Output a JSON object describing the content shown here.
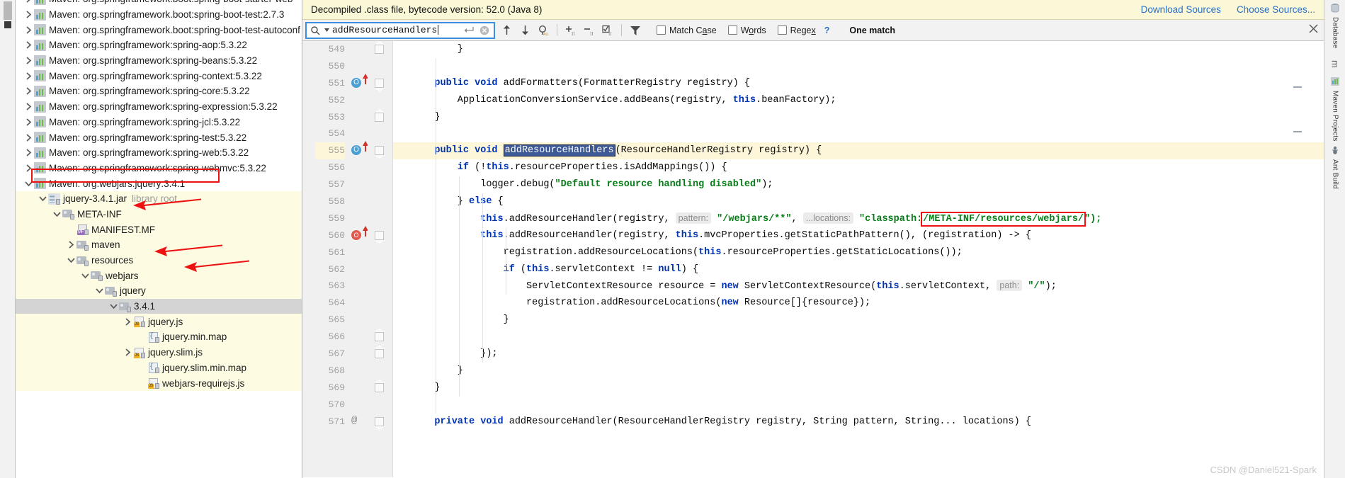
{
  "left_rail": {
    "label": "Database"
  },
  "tree": {
    "rows": [
      {
        "indent": 1,
        "twisty": "right",
        "icon": "maven-library-icon",
        "label": "Maven: org.springframework.boot:spring-boot-starter-web",
        "dim": "",
        "state": "normal",
        "clipped": true
      },
      {
        "indent": 1,
        "twisty": "right",
        "icon": "maven-library-icon",
        "label": "Maven: org.springframework.boot:spring-boot-test:2.7.3",
        "dim": "",
        "state": "normal"
      },
      {
        "indent": 1,
        "twisty": "right",
        "icon": "maven-library-icon",
        "label": "Maven: org.springframework.boot:spring-boot-test-autoconf",
        "dim": "",
        "state": "normal"
      },
      {
        "indent": 1,
        "twisty": "right",
        "icon": "maven-library-icon",
        "label": "Maven: org.springframework:spring-aop:5.3.22",
        "dim": "",
        "state": "normal"
      },
      {
        "indent": 1,
        "twisty": "right",
        "icon": "maven-library-icon",
        "label": "Maven: org.springframework:spring-beans:5.3.22",
        "dim": "",
        "state": "normal"
      },
      {
        "indent": 1,
        "twisty": "right",
        "icon": "maven-library-icon",
        "label": "Maven: org.springframework:spring-context:5.3.22",
        "dim": "",
        "state": "normal"
      },
      {
        "indent": 1,
        "twisty": "right",
        "icon": "maven-library-icon",
        "label": "Maven: org.springframework:spring-core:5.3.22",
        "dim": "",
        "state": "normal"
      },
      {
        "indent": 1,
        "twisty": "right",
        "icon": "maven-library-icon",
        "label": "Maven: org.springframework:spring-expression:5.3.22",
        "dim": "",
        "state": "normal"
      },
      {
        "indent": 1,
        "twisty": "right",
        "icon": "maven-library-icon",
        "label": "Maven: org.springframework:spring-jcl:5.3.22",
        "dim": "",
        "state": "normal"
      },
      {
        "indent": 1,
        "twisty": "right",
        "icon": "maven-library-icon",
        "label": "Maven: org.springframework:spring-test:5.3.22",
        "dim": "",
        "state": "normal"
      },
      {
        "indent": 1,
        "twisty": "right",
        "icon": "maven-library-icon",
        "label": "Maven: org.springframework:spring-web:5.3.22",
        "dim": "",
        "state": "normal"
      },
      {
        "indent": 1,
        "twisty": "right",
        "icon": "maven-library-icon",
        "label": "Maven: org.springframework:spring-webmvc:5.3.22",
        "dim": "",
        "state": "normal"
      },
      {
        "indent": 1,
        "twisty": "down",
        "icon": "maven-library-icon",
        "label": "Maven: org.webjars:jquery:3.4.1",
        "dim": "",
        "state": "normal"
      },
      {
        "indent": 2,
        "twisty": "down",
        "icon": "jar-icon",
        "label": "jquery-3.4.1.jar",
        "dim": "library root",
        "state": "jar"
      },
      {
        "indent": 3,
        "twisty": "down",
        "icon": "folder-icon",
        "label": "META-INF",
        "dim": "",
        "state": "jar"
      },
      {
        "indent": 4,
        "twisty": "none",
        "icon": "manifest-file-icon",
        "label": "MANIFEST.MF",
        "dim": "",
        "state": "jar"
      },
      {
        "indent": 4,
        "twisty": "right",
        "icon": "folder-icon",
        "label": "maven",
        "dim": "",
        "state": "jar"
      },
      {
        "indent": 4,
        "twisty": "down",
        "icon": "folder-icon",
        "label": "resources",
        "dim": "",
        "state": "jar"
      },
      {
        "indent": 5,
        "twisty": "down",
        "icon": "folder-icon",
        "label": "webjars",
        "dim": "",
        "state": "jar"
      },
      {
        "indent": 6,
        "twisty": "down",
        "icon": "folder-icon",
        "label": "jquery",
        "dim": "",
        "state": "jar"
      },
      {
        "indent": 7,
        "twisty": "down",
        "icon": "folder-icon",
        "label": "3.4.1",
        "dim": "",
        "state": "selected"
      },
      {
        "indent": 8,
        "twisty": "right",
        "icon": "js-file-icon",
        "label": "jquery.js",
        "dim": "",
        "state": "jar"
      },
      {
        "indent": 9,
        "twisty": "none",
        "icon": "map-file-icon",
        "label": "jquery.min.map",
        "dim": "",
        "state": "jar"
      },
      {
        "indent": 8,
        "twisty": "right",
        "icon": "js-file-icon",
        "label": "jquery.slim.js",
        "dim": "",
        "state": "jar"
      },
      {
        "indent": 9,
        "twisty": "none",
        "icon": "map-file-icon",
        "label": "jquery.slim.min.map",
        "dim": "",
        "state": "jar"
      },
      {
        "indent": 9,
        "twisty": "none",
        "icon": "js-file-icon",
        "label": "webjars-requirejs.js",
        "dim": "",
        "state": "jar"
      }
    ],
    "annotation_color": "#ee1111"
  },
  "notification": {
    "text": "Decompiled .class file, bytecode version: 52.0 (Java 8)",
    "download_sources": "Download Sources",
    "choose_sources": "Choose Sources...",
    "link_color": "#2a6fc9",
    "background": "#fbf8d7"
  },
  "find_bar": {
    "query": "addResourceHandlers",
    "match_case_label": "Match Case",
    "match_case_checked": false,
    "words_label": "Words",
    "words_checked": false,
    "regex_label": "Regex",
    "regex_checked": false,
    "help_label": "?",
    "result_text": "One match",
    "icons": [
      "search-icon",
      "enter-icon",
      "clear-icon",
      "prev-occurrence-icon",
      "next-occurrence-icon",
      "select-all-occurrences-icon",
      "add-line-icon",
      "remove-line-icon",
      "toggle-selection-icon",
      "filter-icon",
      "close-icon"
    ]
  },
  "editor": {
    "first_line": 549,
    "lines": [
      {
        "num": 549,
        "segments": [
          {
            "t": "        }",
            "c": "plain"
          }
        ],
        "hl": false
      },
      {
        "num": 550,
        "segments": [],
        "hl": false
      },
      {
        "num": 551,
        "segments": [
          {
            "t": "    ",
            "c": "plain"
          },
          {
            "t": "public void",
            "c": "kw"
          },
          {
            "t": " addFormatters(FormatterRegistry registry) {",
            "c": "plain"
          }
        ],
        "hl": false,
        "gutter": "override"
      },
      {
        "num": 552,
        "segments": [
          {
            "t": "        ApplicationConversionService.addBeans(registry, ",
            "c": "plain"
          },
          {
            "t": "this",
            "c": "kw"
          },
          {
            "t": ".beanFactory);",
            "c": "plain"
          }
        ],
        "hl": false
      },
      {
        "num": 553,
        "segments": [
          {
            "t": "    }",
            "c": "plain"
          }
        ],
        "hl": false
      },
      {
        "num": 554,
        "segments": [],
        "hl": false
      },
      {
        "num": 555,
        "segments": [
          {
            "t": "    ",
            "c": "plain"
          },
          {
            "t": "public void",
            "c": "kw"
          },
          {
            "t": " ",
            "c": "plain"
          },
          {
            "t": "addResourceHandlers",
            "c": "selhl"
          },
          {
            "t": "(ResourceHandlerRegistry registry) {",
            "c": "plain"
          }
        ],
        "hl": true,
        "gutter": "override"
      },
      {
        "num": 556,
        "segments": [
          {
            "t": "        ",
            "c": "plain"
          },
          {
            "t": "if",
            "c": "kw"
          },
          {
            "t": " (!",
            "c": "plain"
          },
          {
            "t": "this",
            "c": "kw"
          },
          {
            "t": ".resourceProperties.isAddMappings()) {",
            "c": "plain"
          }
        ],
        "hl": false
      },
      {
        "num": 557,
        "segments": [
          {
            "t": "            logger.debug(",
            "c": "plain"
          },
          {
            "t": "\"Default resource handling disabled\"",
            "c": "str"
          },
          {
            "t": ");",
            "c": "plain"
          }
        ],
        "hl": false
      },
      {
        "num": 558,
        "segments": [
          {
            "t": "        } ",
            "c": "plain"
          },
          {
            "t": "else",
            "c": "kw"
          },
          {
            "t": " {",
            "c": "plain"
          }
        ],
        "hl": false
      },
      {
        "num": 559,
        "segments": [
          {
            "t": "            ",
            "c": "plain"
          },
          {
            "t": "this",
            "c": "kw"
          },
          {
            "t": ".addResourceHandler(registry, ",
            "c": "plain"
          },
          {
            "t": "pattern:",
            "c": "hint"
          },
          {
            "t": " ",
            "c": "plain"
          },
          {
            "t": "\"/webjars/**\"",
            "c": "str"
          },
          {
            "t": ", ",
            "c": "plain"
          },
          {
            "t": "...locations:",
            "c": "hint"
          },
          {
            "t": " ",
            "c": "plain"
          },
          {
            "t": "\"classpath:",
            "c": "str"
          },
          {
            "t": "/META-INF/resources/webjars/",
            "c": "str-boxed"
          },
          {
            "t": "\");",
            "c": "str"
          }
        ],
        "hl": false
      },
      {
        "num": 560,
        "segments": [
          {
            "t": "            ",
            "c": "plain"
          },
          {
            "t": "this",
            "c": "kw"
          },
          {
            "t": ".addResourceHandler(registry, ",
            "c": "plain"
          },
          {
            "t": "this",
            "c": "kw"
          },
          {
            "t": ".mvcProperties.getStaticPathPattern(), ",
            "c": "plain"
          },
          {
            "t": "(registration)",
            "c": "plain"
          },
          {
            "t": " -> {",
            "c": "plain"
          }
        ],
        "hl": false,
        "gutter": "impl"
      },
      {
        "num": 561,
        "segments": [
          {
            "t": "                registration.addResourceLocations(",
            "c": "plain"
          },
          {
            "t": "this",
            "c": "kw"
          },
          {
            "t": ".resourceProperties.getStaticLocations());",
            "c": "plain"
          }
        ],
        "hl": false
      },
      {
        "num": 562,
        "segments": [
          {
            "t": "                ",
            "c": "plain"
          },
          {
            "t": "if",
            "c": "kw"
          },
          {
            "t": " (",
            "c": "plain"
          },
          {
            "t": "this",
            "c": "kw"
          },
          {
            "t": ".servletContext != ",
            "c": "plain"
          },
          {
            "t": "null",
            "c": "kw"
          },
          {
            "t": ") {",
            "c": "plain"
          }
        ],
        "hl": false
      },
      {
        "num": 563,
        "segments": [
          {
            "t": "                    ServletContextResource resource = ",
            "c": "plain"
          },
          {
            "t": "new",
            "c": "kw"
          },
          {
            "t": " ServletContextResource(",
            "c": "plain"
          },
          {
            "t": "this",
            "c": "kw"
          },
          {
            "t": ".servletContext, ",
            "c": "plain"
          },
          {
            "t": "path:",
            "c": "hint"
          },
          {
            "t": " ",
            "c": "plain"
          },
          {
            "t": "\"/\"",
            "c": "str"
          },
          {
            "t": ");",
            "c": "plain"
          }
        ],
        "hl": false
      },
      {
        "num": 564,
        "segments": [
          {
            "t": "                    registration.addResourceLocations(",
            "c": "plain"
          },
          {
            "t": "new",
            "c": "kw"
          },
          {
            "t": " Resource[]{resource});",
            "c": "plain"
          }
        ],
        "hl": false
      },
      {
        "num": 565,
        "segments": [
          {
            "t": "                }",
            "c": "plain"
          }
        ],
        "hl": false
      },
      {
        "num": 566,
        "segments": [],
        "hl": false
      },
      {
        "num": 567,
        "segments": [
          {
            "t": "            });",
            "c": "plain"
          }
        ],
        "hl": false
      },
      {
        "num": 568,
        "segments": [
          {
            "t": "        }",
            "c": "plain"
          }
        ],
        "hl": false
      },
      {
        "num": 569,
        "segments": [
          {
            "t": "    }",
            "c": "plain"
          }
        ],
        "hl": false
      },
      {
        "num": 570,
        "segments": [],
        "hl": false
      },
      {
        "num": 571,
        "segments": [
          {
            "t": "    ",
            "c": "plain"
          },
          {
            "t": "private void",
            "c": "kw"
          },
          {
            "t": " addResourceHandler(ResourceHandlerRegistry registry, String pattern, String... locations) {",
            "c": "plain"
          }
        ],
        "hl": false,
        "gutter": "at"
      }
    ]
  },
  "right_rail": {
    "items": [
      {
        "label": "Database",
        "icon": "database-icon"
      },
      {
        "label": "m",
        "icon": "maven-m-icon"
      },
      {
        "label": "Maven Projects",
        "icon": "maven-icon"
      },
      {
        "label": "Ant Build",
        "icon": "ant-icon"
      }
    ]
  },
  "watermark": {
    "text": "CSDN @Daniel521-Spark"
  }
}
